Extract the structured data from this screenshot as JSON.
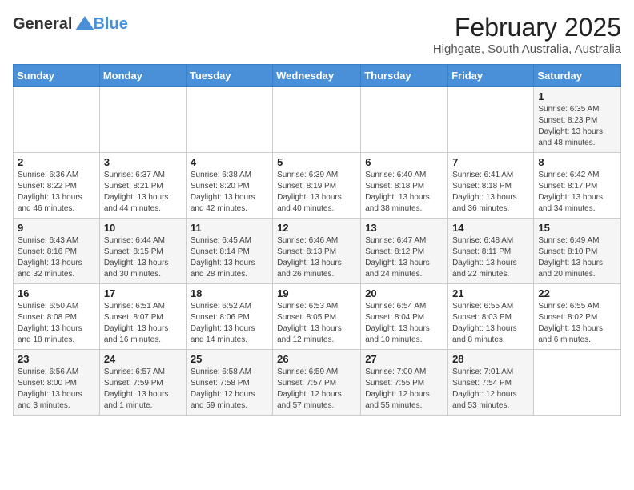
{
  "logo": {
    "text_general": "General",
    "text_blue": "Blue"
  },
  "title": {
    "month": "February 2025",
    "location": "Highgate, South Australia, Australia"
  },
  "headers": [
    "Sunday",
    "Monday",
    "Tuesday",
    "Wednesday",
    "Thursday",
    "Friday",
    "Saturday"
  ],
  "weeks": [
    [
      {
        "day": "",
        "info": ""
      },
      {
        "day": "",
        "info": ""
      },
      {
        "day": "",
        "info": ""
      },
      {
        "day": "",
        "info": ""
      },
      {
        "day": "",
        "info": ""
      },
      {
        "day": "",
        "info": ""
      },
      {
        "day": "1",
        "info": "Sunrise: 6:35 AM\nSunset: 8:23 PM\nDaylight: 13 hours\nand 48 minutes."
      }
    ],
    [
      {
        "day": "2",
        "info": "Sunrise: 6:36 AM\nSunset: 8:22 PM\nDaylight: 13 hours\nand 46 minutes."
      },
      {
        "day": "3",
        "info": "Sunrise: 6:37 AM\nSunset: 8:21 PM\nDaylight: 13 hours\nand 44 minutes."
      },
      {
        "day": "4",
        "info": "Sunrise: 6:38 AM\nSunset: 8:20 PM\nDaylight: 13 hours\nand 42 minutes."
      },
      {
        "day": "5",
        "info": "Sunrise: 6:39 AM\nSunset: 8:19 PM\nDaylight: 13 hours\nand 40 minutes."
      },
      {
        "day": "6",
        "info": "Sunrise: 6:40 AM\nSunset: 8:18 PM\nDaylight: 13 hours\nand 38 minutes."
      },
      {
        "day": "7",
        "info": "Sunrise: 6:41 AM\nSunset: 8:18 PM\nDaylight: 13 hours\nand 36 minutes."
      },
      {
        "day": "8",
        "info": "Sunrise: 6:42 AM\nSunset: 8:17 PM\nDaylight: 13 hours\nand 34 minutes."
      }
    ],
    [
      {
        "day": "9",
        "info": "Sunrise: 6:43 AM\nSunset: 8:16 PM\nDaylight: 13 hours\nand 32 minutes."
      },
      {
        "day": "10",
        "info": "Sunrise: 6:44 AM\nSunset: 8:15 PM\nDaylight: 13 hours\nand 30 minutes."
      },
      {
        "day": "11",
        "info": "Sunrise: 6:45 AM\nSunset: 8:14 PM\nDaylight: 13 hours\nand 28 minutes."
      },
      {
        "day": "12",
        "info": "Sunrise: 6:46 AM\nSunset: 8:13 PM\nDaylight: 13 hours\nand 26 minutes."
      },
      {
        "day": "13",
        "info": "Sunrise: 6:47 AM\nSunset: 8:12 PM\nDaylight: 13 hours\nand 24 minutes."
      },
      {
        "day": "14",
        "info": "Sunrise: 6:48 AM\nSunset: 8:11 PM\nDaylight: 13 hours\nand 22 minutes."
      },
      {
        "day": "15",
        "info": "Sunrise: 6:49 AM\nSunset: 8:10 PM\nDaylight: 13 hours\nand 20 minutes."
      }
    ],
    [
      {
        "day": "16",
        "info": "Sunrise: 6:50 AM\nSunset: 8:08 PM\nDaylight: 13 hours\nand 18 minutes."
      },
      {
        "day": "17",
        "info": "Sunrise: 6:51 AM\nSunset: 8:07 PM\nDaylight: 13 hours\nand 16 minutes."
      },
      {
        "day": "18",
        "info": "Sunrise: 6:52 AM\nSunset: 8:06 PM\nDaylight: 13 hours\nand 14 minutes."
      },
      {
        "day": "19",
        "info": "Sunrise: 6:53 AM\nSunset: 8:05 PM\nDaylight: 13 hours\nand 12 minutes."
      },
      {
        "day": "20",
        "info": "Sunrise: 6:54 AM\nSunset: 8:04 PM\nDaylight: 13 hours\nand 10 minutes."
      },
      {
        "day": "21",
        "info": "Sunrise: 6:55 AM\nSunset: 8:03 PM\nDaylight: 13 hours\nand 8 minutes."
      },
      {
        "day": "22",
        "info": "Sunrise: 6:55 AM\nSunset: 8:02 PM\nDaylight: 13 hours\nand 6 minutes."
      }
    ],
    [
      {
        "day": "23",
        "info": "Sunrise: 6:56 AM\nSunset: 8:00 PM\nDaylight: 13 hours\nand 3 minutes."
      },
      {
        "day": "24",
        "info": "Sunrise: 6:57 AM\nSunset: 7:59 PM\nDaylight: 13 hours\nand 1 minute."
      },
      {
        "day": "25",
        "info": "Sunrise: 6:58 AM\nSunset: 7:58 PM\nDaylight: 12 hours\nand 59 minutes."
      },
      {
        "day": "26",
        "info": "Sunrise: 6:59 AM\nSunset: 7:57 PM\nDaylight: 12 hours\nand 57 minutes."
      },
      {
        "day": "27",
        "info": "Sunrise: 7:00 AM\nSunset: 7:55 PM\nDaylight: 12 hours\nand 55 minutes."
      },
      {
        "day": "28",
        "info": "Sunrise: 7:01 AM\nSunset: 7:54 PM\nDaylight: 12 hours\nand 53 minutes."
      },
      {
        "day": "",
        "info": ""
      }
    ]
  ]
}
